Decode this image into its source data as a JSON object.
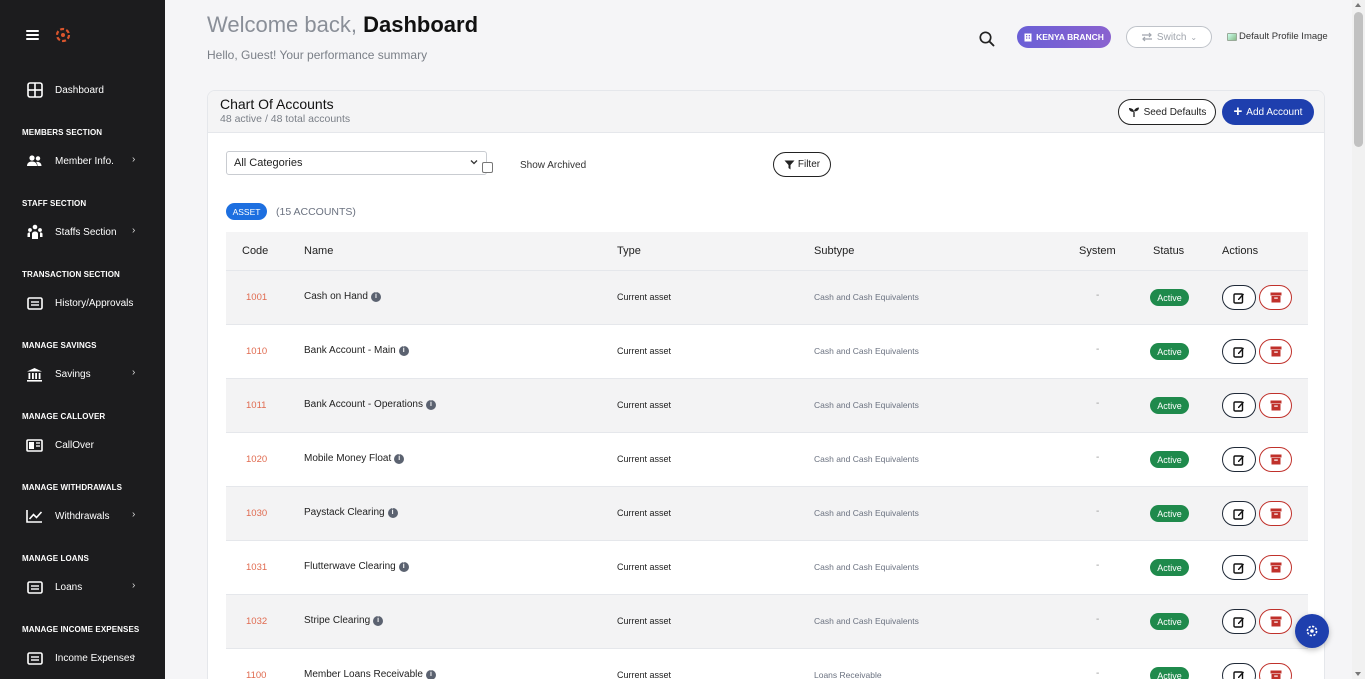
{
  "sidebar": {
    "items": [
      {
        "label": "Dashboard",
        "icon": "grid-icon"
      },
      {
        "section": "MEMBERS SECTION"
      },
      {
        "label": "Member Info.",
        "icon": "users-icon",
        "chevron": true
      },
      {
        "section": "STAFF SECTION"
      },
      {
        "label": "Staffs Section",
        "icon": "staff-icon",
        "chevron": true
      },
      {
        "section": "TRANSACTION SECTION"
      },
      {
        "label": "History/Approvals",
        "icon": "list-icon"
      },
      {
        "section": "MANAGE SAVINGS"
      },
      {
        "label": "Savings",
        "icon": "bank-icon",
        "chevron": true
      },
      {
        "section": "MANAGE CALLOVER"
      },
      {
        "label": "CallOver",
        "icon": "panel-icon"
      },
      {
        "section": "MANAGE WITHDRAWALS"
      },
      {
        "label": "Withdrawals",
        "icon": "chart-icon",
        "chevron": true
      },
      {
        "section": "MANAGE LOANS"
      },
      {
        "label": "Loans",
        "icon": "list-icon",
        "chevron": true
      },
      {
        "section": "MANAGE INCOME EXPENSES"
      },
      {
        "label": "Income Expenses",
        "icon": "list-icon",
        "chevron": true
      }
    ]
  },
  "header": {
    "greeting_prefix": "Welcome back,",
    "greeting_name": "Dashboard",
    "subtitle": "Hello, Guest! Your performance summary",
    "branch": "KENYA BRANCH",
    "switch_label": "Switch",
    "profile_alt": "Default Profile Image"
  },
  "card": {
    "title": "Chart Of Accounts",
    "subtitle": "48 active / 48 total accounts",
    "seed_label": "Seed Defaults",
    "add_label": "Add Account",
    "category_select": "All Categories",
    "show_archived": "Show Archived",
    "filter_label": "Filter",
    "group_badge": "ASSET",
    "group_count": "(15 ACCOUNTS)"
  },
  "table": {
    "columns": [
      "Code",
      "Name",
      "Type",
      "Subtype",
      "System",
      "Status",
      "Actions"
    ],
    "rows": [
      {
        "code": "1001",
        "name": "Cash on Hand",
        "type": "Current asset",
        "subtype": "Cash and Cash Equivalents",
        "system": "-",
        "status": "Active"
      },
      {
        "code": "1010",
        "name": "Bank Account - Main",
        "type": "Current asset",
        "subtype": "Cash and Cash Equivalents",
        "system": "-",
        "status": "Active"
      },
      {
        "code": "1011",
        "name": "Bank Account - Operations",
        "type": "Current asset",
        "subtype": "Cash and Cash Equivalents",
        "system": "-",
        "status": "Active"
      },
      {
        "code": "1020",
        "name": "Mobile Money Float",
        "type": "Current asset",
        "subtype": "Cash and Cash Equivalents",
        "system": "-",
        "status": "Active"
      },
      {
        "code": "1030",
        "name": "Paystack Clearing",
        "type": "Current asset",
        "subtype": "Cash and Cash Equivalents",
        "system": "-",
        "status": "Active"
      },
      {
        "code": "1031",
        "name": "Flutterwave Clearing",
        "type": "Current asset",
        "subtype": "Cash and Cash Equivalents",
        "system": "-",
        "status": "Active"
      },
      {
        "code": "1032",
        "name": "Stripe Clearing",
        "type": "Current asset",
        "subtype": "Cash and Cash Equivalents",
        "system": "-",
        "status": "Active"
      },
      {
        "code": "1100",
        "name": "Member Loans Receivable",
        "type": "Current asset",
        "subtype": "Loans Receivable",
        "system": "-",
        "status": "Active"
      }
    ]
  },
  "colors": {
    "sidebar_bg": "#1c1c1e",
    "primary": "#1e3fae",
    "active_green": "#1f8a4c",
    "code_orange": "#e06a4f",
    "delete_red": "#c0312b"
  }
}
